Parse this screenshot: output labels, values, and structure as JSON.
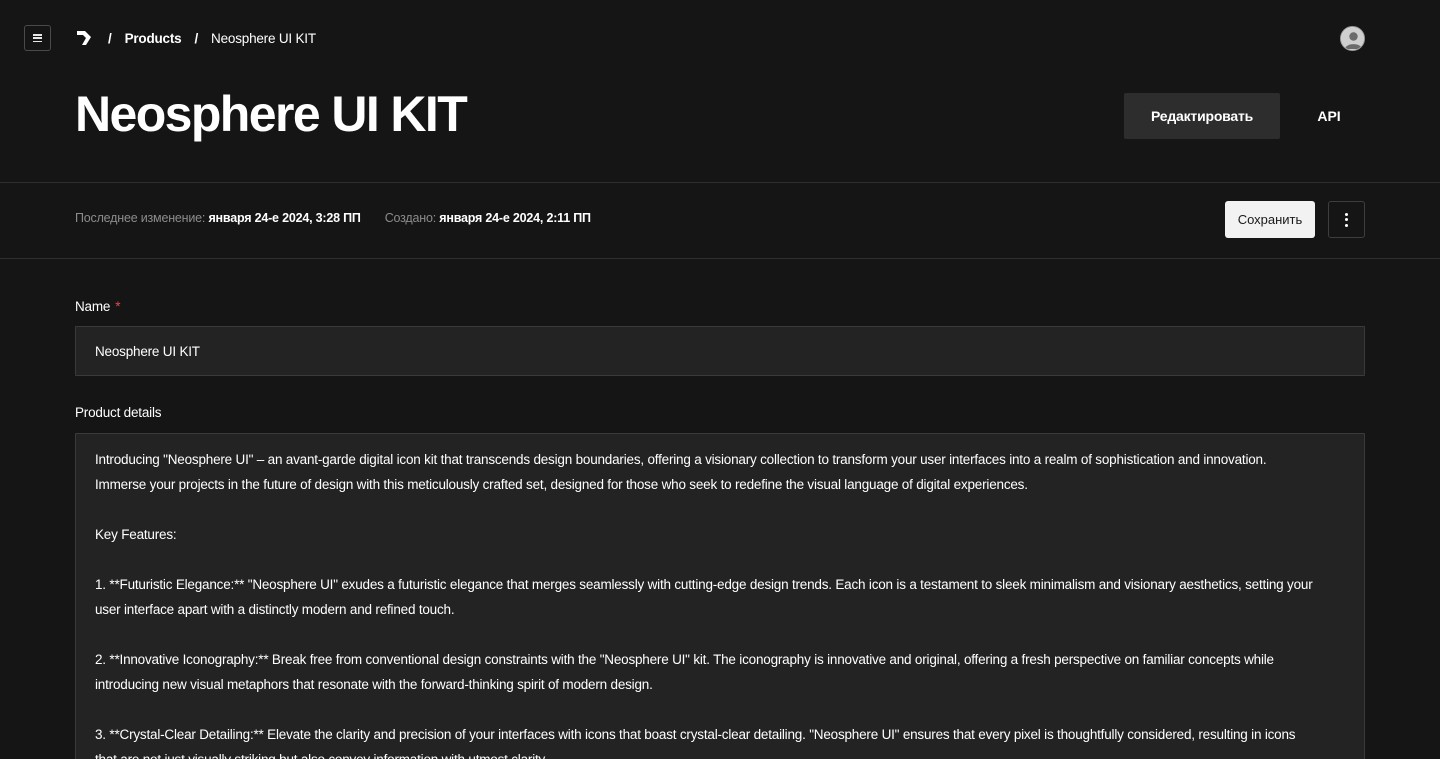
{
  "nav": {
    "breadcrumb": [
      "Products",
      "Neosphere UI KIT"
    ],
    "separator": "/"
  },
  "header": {
    "title": "Neosphere UI KIT",
    "edit_label": "Редактировать",
    "api_label": "API"
  },
  "meta": {
    "modified_label": "Последнее изменение:",
    "modified_value": "января 24-е 2024, 3:28 ПП",
    "created_label": "Создано:",
    "created_value": "января 24-е 2024, 2:11 ПП",
    "save_label": "Сохранить"
  },
  "form": {
    "name_label": "Name",
    "required_mark": "*",
    "name_value": "Neosphere UI KIT",
    "details_label": "Product details",
    "details_lines": [
      "Introducing \"Neosphere UI\" – an avant-garde digital icon kit that transcends design boundaries, offering a visionary collection to transform your user interfaces into a realm of sophistication and innovation.",
      "Immerse your projects in the future of design with this meticulously crafted set, designed for those who seek to redefine the visual language of digital experiences.",
      "",
      "Key Features:",
      "",
      "1. **Futuristic Elegance:** \"Neosphere UI\" exudes a futuristic elegance that merges seamlessly with cutting-edge design trends. Each icon is a testament to sleek minimalism and visionary aesthetics, setting your",
      "user interface apart with a distinctly modern and refined touch.",
      "",
      "2. **Innovative Iconography:** Break free from conventional design constraints with the \"Neosphere UI\" kit. The iconography is innovative and original, offering a fresh perspective on familiar concepts while",
      "introducing new visual metaphors that resonate with the forward-thinking spirit of modern design.",
      "",
      "3. **Crystal-Clear Detailing:** Elevate the clarity and precision of your interfaces with icons that boast crystal-clear detailing. \"Neosphere UI\" ensures that every pixel is thoughtfully considered, resulting in icons",
      "that are not just visually striking but also convey information with utmost clarity."
    ]
  },
  "icons": {
    "menu": "menu-icon",
    "logo": "logo-icon",
    "avatar": "user-avatar-icon",
    "more": "more-vertical-icon"
  },
  "colors": {
    "background": "#151515",
    "surface": "#232323",
    "button_dark": "#2d2d2d",
    "button_light": "#f2f2f2",
    "required": "#e5484d"
  }
}
